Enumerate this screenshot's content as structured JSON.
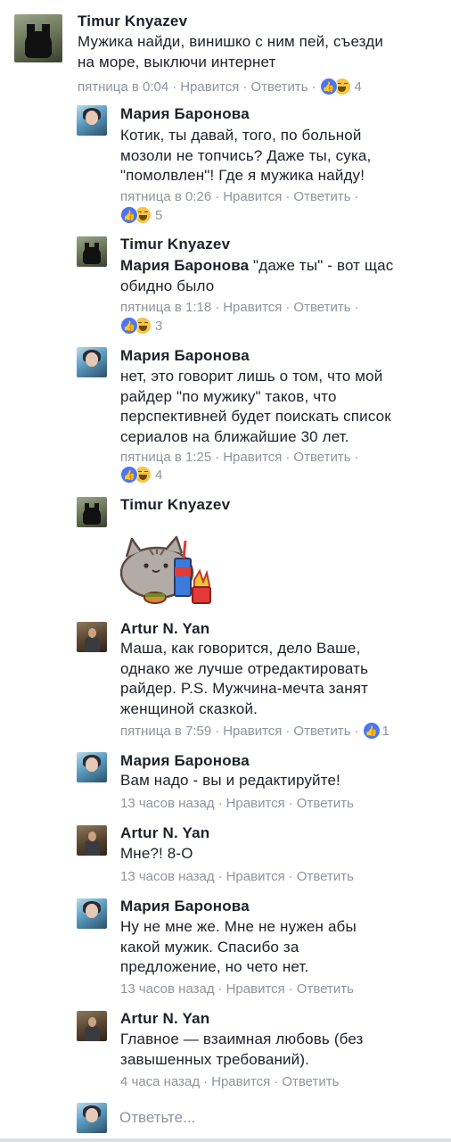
{
  "comments": [
    {
      "author": "Timur Knyazev",
      "avatar": "dragon-avatar",
      "lines": [
        "Мужика найди, винишко с ним пей, съезди",
        "на море, выключи интернет"
      ],
      "time": "пятница в 0:04",
      "like": "Нравится",
      "reply": "Ответить",
      "reaction_count": "4"
    },
    {
      "author": "Мария Баронова",
      "avatar": "maria-avatar",
      "lines": [
        "Котик, ты давай, того, по больной",
        "мозоли не топчись? Даже ты, сука,",
        "\"помолвлен\"! Где я мужика найду!"
      ],
      "time": "пятница в 0:26",
      "like": "Нравится",
      "reply": "Ответить",
      "reaction_count": "5"
    },
    {
      "author": "Timur Knyazev",
      "avatar": "dragon-avatar",
      "mention": "Мария Баронова",
      "lines": [
        " \"даже ты\" - вот щас",
        "обидно было"
      ],
      "time": "пятница в 1:18",
      "like": "Нравится",
      "reply": "Ответить",
      "reaction_count": "3"
    },
    {
      "author": "Мария Баронова",
      "avatar": "maria-avatar",
      "lines": [
        "нет, это говорит лишь о том, что мой",
        "райдер \"по мужику\" таков, что",
        "перспективней будет поискать список",
        "сериалов на ближайшие 30 лет."
      ],
      "time": "пятница в 1:25",
      "like": "Нравится",
      "reply": "Ответить",
      "reaction_count": "4"
    },
    {
      "author": "Timur Knyazev",
      "avatar": "dragon-avatar",
      "sticker": "pusheen-cat-fastfood-sticker"
    },
    {
      "author": "Artur N. Yan",
      "avatar": "artur-avatar",
      "lines": [
        "Маша, как говорится, дело Ваше,",
        "однако же лучше отредактировать",
        "райдер. P.S. Мужчина-мечта занят",
        "женщиной сказкой."
      ],
      "time": "пятница в 7:59",
      "like": "Нравится",
      "reply": "Ответить",
      "reaction_count": "1"
    },
    {
      "author": "Мария Баронова",
      "avatar": "maria-avatar",
      "lines": [
        "Вам надо - вы и редактируйте!"
      ],
      "time": "13 часов назад",
      "like": "Нравится",
      "reply": "Ответить"
    },
    {
      "author": "Artur N. Yan",
      "avatar": "artur-avatar",
      "lines": [
        "Мне?! 8-О"
      ],
      "time": "13 часов назад",
      "like": "Нравится",
      "reply": "Ответить"
    },
    {
      "author": "Мария Баронова",
      "avatar": "maria-avatar",
      "lines": [
        "Ну не мне же. Мне не нужен абы",
        "какой мужик. Спасибо за",
        "предложение, но чето нет."
      ],
      "time": "13 часов назад",
      "like": "Нравится",
      "reply": "Ответить"
    },
    {
      "author": "Artur N. Yan",
      "avatar": "artur-avatar",
      "lines": [
        "Главное — взаимная любовь (без",
        "завышенных требований)."
      ],
      "time": "4 часа назад",
      "like": "Нравится",
      "reply": "Ответить"
    }
  ],
  "separator": "·",
  "reply_box": {
    "placeholder": "Ответьте..."
  },
  "colors": {
    "like_blue": "#4a76f0",
    "haha_yellow": "#f7c443",
    "meta_gray": "#90949c",
    "text": "#1d2129"
  }
}
